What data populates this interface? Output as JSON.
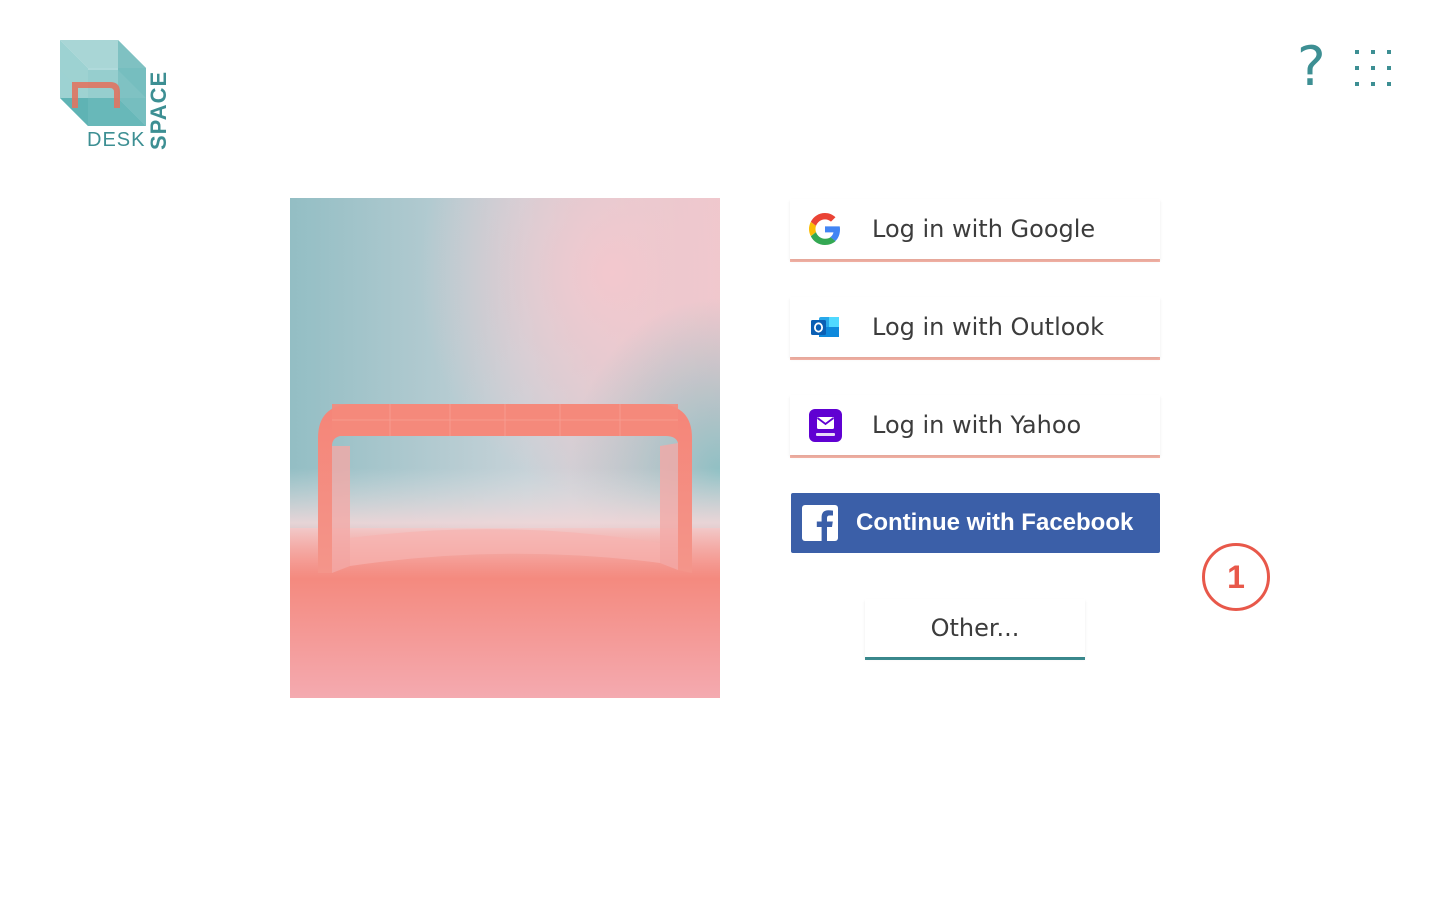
{
  "brand": {
    "word_desk": "DESK",
    "word_space": "SPACE",
    "teal": "#3d8f93",
    "coral": "#f07a68"
  },
  "header": {
    "help_icon": "?",
    "apps_icon": "apps-grid-icon"
  },
  "hero": {
    "subject": "coral-desk-photo"
  },
  "login": {
    "google_label": "Log in with Google",
    "outlook_label": "Log in with Outlook",
    "yahoo_label": "Log in with Yahoo",
    "facebook_label": "Continue with Facebook",
    "other_label": "Other..."
  },
  "annotation": {
    "step_number": "1",
    "color": "#e8584a"
  },
  "colors": {
    "facebook_blue": "#3b5fa8",
    "button_underline_coral": "#f6b3a6",
    "other_underline_teal": "#3d8f93"
  }
}
